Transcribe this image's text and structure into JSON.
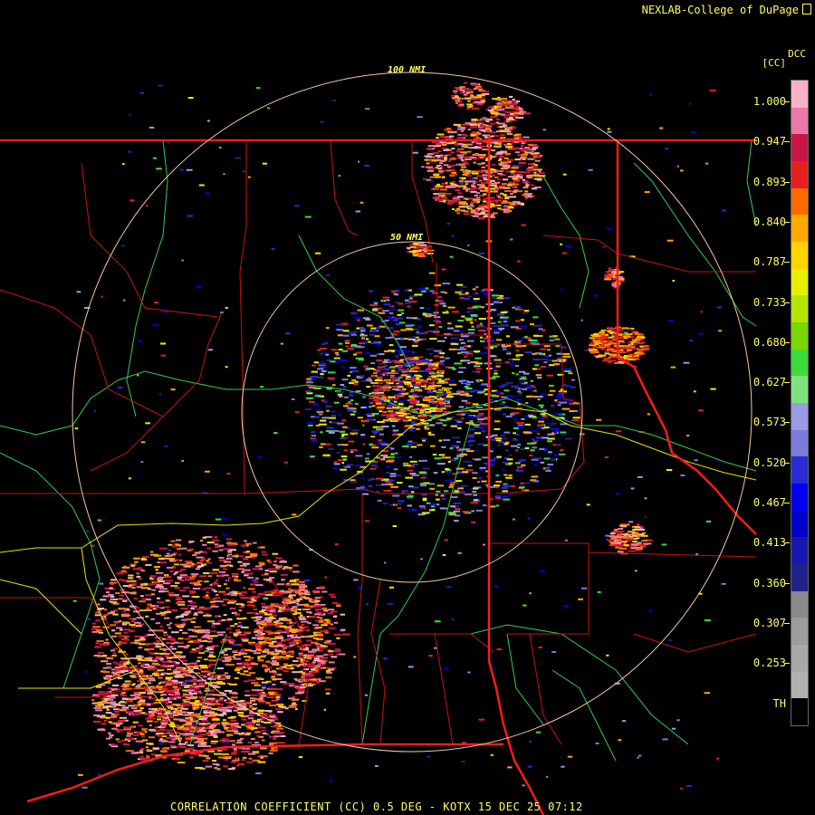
{
  "header": {
    "credit": "NEXLAB-College of DuPage",
    "credit_icon": "external-link-icon",
    "site_code": "DCC",
    "product_unit": "[CC]"
  },
  "footer": {
    "caption": "CORRELATION COEFFICIENT (CC) 0.5 DEG - KOTX 15 DEC 25 07:12"
  },
  "range_rings": [
    {
      "label": "50 NMI"
    },
    {
      "label": "100 NMI"
    }
  ],
  "colorbar": {
    "labels": [
      "1.000",
      "0.947",
      "0.893",
      "0.840",
      "0.787",
      "0.733",
      "0.680",
      "0.627",
      "0.573",
      "0.520",
      "0.467",
      "0.413",
      "0.360",
      "0.307",
      "0.253",
      "TH"
    ],
    "colors": [
      "#f9b1c8",
      "#e97aa7",
      "#c8154a",
      "#e62020",
      "#ff6a00",
      "#ffa800",
      "#ffd400",
      "#e6f000",
      "#b4e600",
      "#78d800",
      "#3cdc3c",
      "#7ee37e",
      "#9a9ae6",
      "#7b7bdc",
      "#2a2ad6",
      "#0000f0",
      "#0000c8",
      "#1818b0",
      "#22228a",
      "#8a8a8a",
      "#9c9c9c",
      "#a8a8a8",
      "#b0b0b0",
      "#000000"
    ]
  },
  "map_colors": {
    "state_border": "#ff1a1a",
    "county_border": "#cc1111",
    "river": "#33cc55",
    "highway": "#e6e600",
    "ring": "#f2c8a0"
  }
}
